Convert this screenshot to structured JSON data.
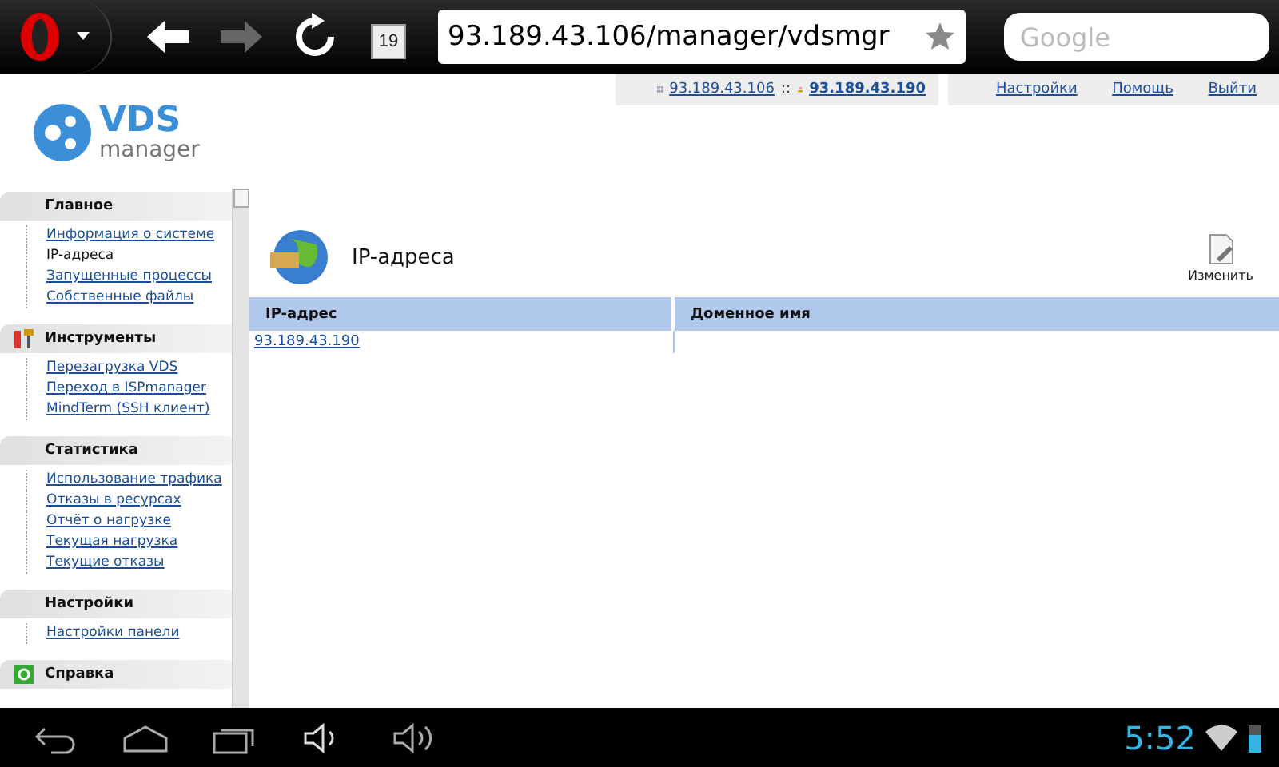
{
  "browser": {
    "tab_count": "19",
    "url": "93.189.43.106/manager/vdsmgr",
    "search": {
      "placeholder": "Google"
    }
  },
  "header": {
    "server": "93.189.43.106",
    "separator": "::",
    "user": "93.189.43.190",
    "links": [
      "Настройки",
      "Помощь",
      "Выйти"
    ]
  },
  "logo": {
    "title": "VDS",
    "subtitle": "manager"
  },
  "sidebar": [
    {
      "title": "Главное",
      "kind": "plain",
      "items": [
        {
          "label": "Информация о системе",
          "selected": false
        },
        {
          "label": "IP-адреса",
          "selected": true
        },
        {
          "label": "Запущенные процессы",
          "selected": false
        },
        {
          "label": "Собственные файлы",
          "selected": false
        }
      ]
    },
    {
      "title": "Инструменты",
      "kind": "tools",
      "items": [
        {
          "label": "Перезагрузка VDS",
          "selected": false
        },
        {
          "label": "Переход в ISPmanager",
          "selected": false
        },
        {
          "label": "MindTerm (SSH клиент)",
          "selected": false
        }
      ]
    },
    {
      "title": "Статистика",
      "kind": "plain",
      "items": [
        {
          "label": "Использование трафика",
          "selected": false
        },
        {
          "label": "Отказы в ресурсах",
          "selected": false
        },
        {
          "label": "Отчёт о нагрузке",
          "selected": false
        },
        {
          "label": "Текущая нагрузка",
          "selected": false
        },
        {
          "label": "Текущие отказы",
          "selected": false
        }
      ]
    },
    {
      "title": "Настройки",
      "kind": "plain",
      "items": [
        {
          "label": "Настройки панели",
          "selected": false
        }
      ]
    },
    {
      "title": "Справка",
      "kind": "help"
    }
  ],
  "page": {
    "title": "IP-адреса",
    "actions": [
      "Изменить"
    ]
  },
  "table": {
    "columns": [
      "IP-адрес",
      "Доменное имя"
    ],
    "rows": [
      [
        "93.189.43.190",
        ""
      ]
    ]
  },
  "navbar": {
    "time": "5:52"
  }
}
